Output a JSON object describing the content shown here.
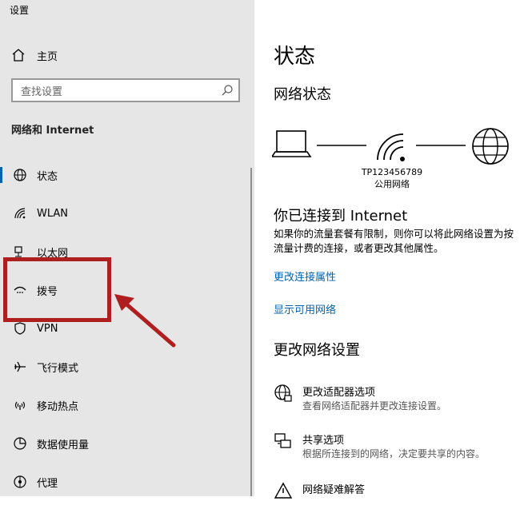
{
  "window": {
    "title": "设置"
  },
  "sidebar": {
    "home_label": "主页",
    "search_placeholder": "查找设置",
    "section_title": "网络和 Internet",
    "items": [
      {
        "label": "状态",
        "icon": "globe-icon",
        "active": true
      },
      {
        "label": "WLAN",
        "icon": "wifi-icon"
      },
      {
        "label": "以太网",
        "icon": "ethernet-icon"
      },
      {
        "label": "拨号",
        "icon": "dialup-icon"
      },
      {
        "label": "VPN",
        "icon": "vpn-icon"
      },
      {
        "label": "飞行模式",
        "icon": "airplane-icon"
      },
      {
        "label": "移动热点",
        "icon": "hotspot-icon"
      },
      {
        "label": "数据使用量",
        "icon": "data-usage-icon"
      },
      {
        "label": "代理",
        "icon": "proxy-icon"
      }
    ]
  },
  "main": {
    "title": "状态",
    "network_status_heading": "网络状态",
    "network_name": "TP123456789",
    "network_type": "公用网络",
    "connected_title": "你已连接到 Internet",
    "connected_desc": "如果你的流量套餐有限制，则你可以将此网络设置为按流量计费的连接，或者更改其他属性。",
    "link_change_properties": "更改连接属性",
    "link_show_networks": "显示可用网络",
    "change_settings_heading": "更改网络设置",
    "options": [
      {
        "title": "更改适配器选项",
        "desc": "查看网络适配器并更改连接设置。",
        "icon": "adapter-globe-icon"
      },
      {
        "title": "共享选项",
        "desc": "根据所连接到的网络，决定要共享的内容。",
        "icon": "sharing-icon"
      },
      {
        "title": "网络疑难解答",
        "desc": "",
        "icon": "warning-icon"
      }
    ]
  },
  "annotation": {
    "color": "#b01f1f"
  },
  "colors": {
    "accent": "#0063b1",
    "sidebar_bg": "#e6e6e6"
  }
}
